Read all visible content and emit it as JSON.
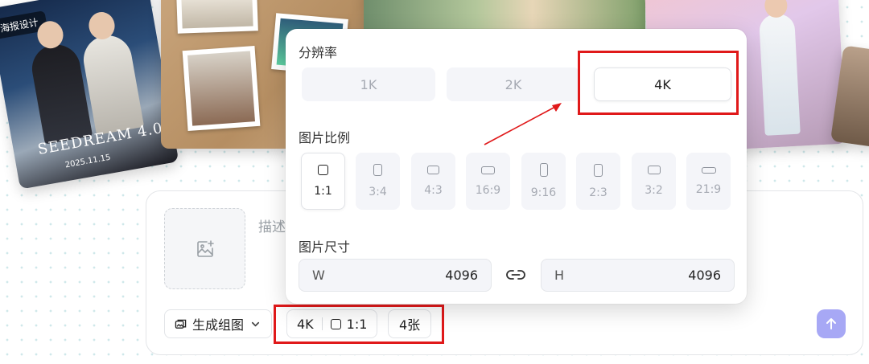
{
  "gallery": {
    "poster_tag": "海报设计",
    "poster_title": "SEEDREAM 4.0",
    "poster_date": "2025.11.15"
  },
  "popover": {
    "resolution_label": "分辨率",
    "resolutions": [
      {
        "label": "1K",
        "selected": false
      },
      {
        "label": "2K",
        "selected": false
      },
      {
        "label": "4K",
        "selected": true
      }
    ],
    "ratio_label": "图片比例",
    "ratios": [
      {
        "label": "1:1",
        "selected": true
      },
      {
        "label": "3:4",
        "selected": false
      },
      {
        "label": "4:3",
        "selected": false
      },
      {
        "label": "16:9",
        "selected": false
      },
      {
        "label": "9:16",
        "selected": false
      },
      {
        "label": "2:3",
        "selected": false
      },
      {
        "label": "3:2",
        "selected": false
      },
      {
        "label": "21:9",
        "selected": false
      }
    ],
    "size_label": "图片尺寸",
    "width": {
      "label": "W",
      "value": "4096"
    },
    "height": {
      "label": "H",
      "value": "4096"
    }
  },
  "prompt": {
    "placeholder": "描述",
    "mode_label": "生成组图",
    "resolution_chip": "4K",
    "ratio_chip": "1:1",
    "count_chip": "4张"
  },
  "colors": {
    "highlight": "#e0191a",
    "send_button": "#a7a8f5",
    "dot_pattern": "#cfe8ea"
  }
}
